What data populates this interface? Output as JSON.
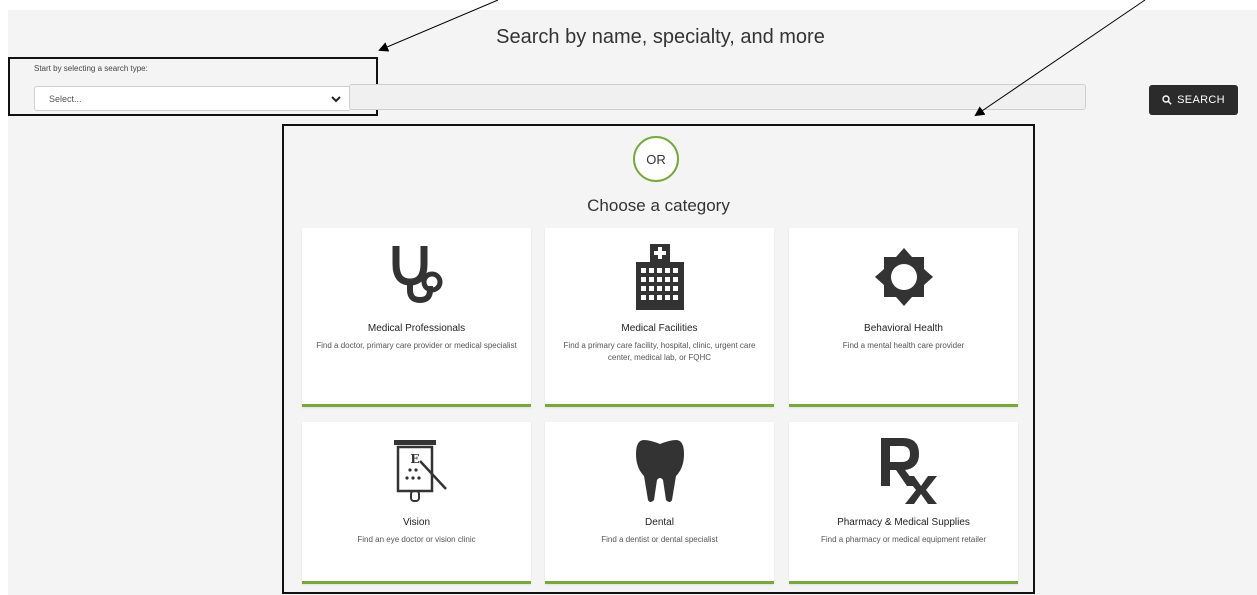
{
  "header": {
    "title": "Search by name, specialty, and more"
  },
  "search": {
    "type_label": "Start by selecting a search type:",
    "type_value": "Select...",
    "button_label": "SEARCH",
    "input_value": ""
  },
  "divider": {
    "or_text": "OR"
  },
  "categories": {
    "heading": "Choose a category",
    "items": [
      {
        "title": "Medical Professionals",
        "description": "Find a doctor, primary care provider or medical specialist",
        "icon": "stethoscope-icon"
      },
      {
        "title": "Medical Facilities",
        "description": "Find a primary care facility, hospital, clinic, urgent care center, medical lab, or FQHC",
        "icon": "hospital-building-icon"
      },
      {
        "title": "Behavioral Health",
        "description": "Find a mental health care provider",
        "icon": "sun-icon"
      },
      {
        "title": "Vision",
        "description": "Find an eye doctor or vision clinic",
        "icon": "eye-chart-icon"
      },
      {
        "title": "Dental",
        "description": "Find a dentist or dental specialist",
        "icon": "tooth-icon"
      },
      {
        "title": "Pharmacy & Medical Supplies",
        "description": "Find a pharmacy or medical equipment retailer",
        "icon": "rx-icon"
      }
    ]
  },
  "colors": {
    "accent": "#76a83c",
    "button": "#2b2b2b",
    "background": "#f4f4f4"
  }
}
